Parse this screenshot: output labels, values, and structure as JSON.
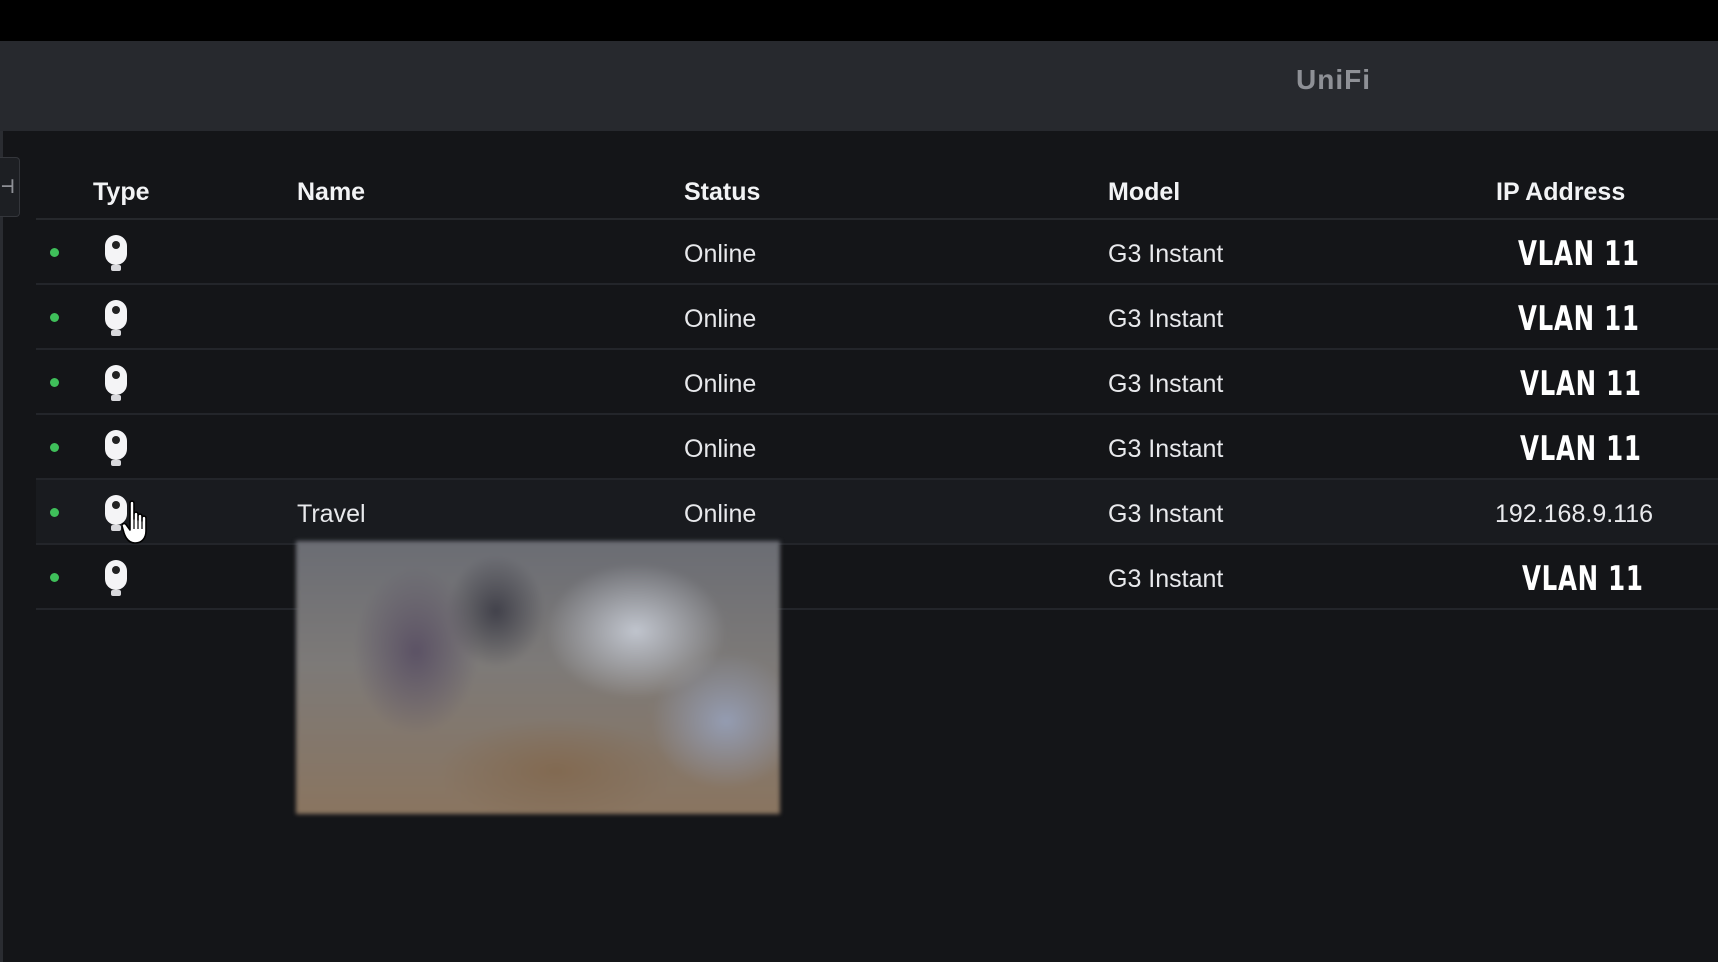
{
  "app": {
    "brand": "UniFi"
  },
  "sidebar": {
    "collapse_glyph": "⊣"
  },
  "table": {
    "columns": {
      "type": "Type",
      "name": "Name",
      "status": "Status",
      "model": "Model",
      "ip": "IP Address"
    },
    "rows": [
      {
        "name": "",
        "status": "Online",
        "model": "G3 Instant",
        "ip": "VLAN 11"
      },
      {
        "name": "",
        "status": "Online",
        "model": "G3 Instant",
        "ip": "VLAN 11"
      },
      {
        "name": "",
        "status": "Online",
        "model": "G3 Instant",
        "ip": "VLAN 11"
      },
      {
        "name": "",
        "status": "Online",
        "model": "G3 Instant",
        "ip": "VLAN 11"
      },
      {
        "name": "Travel",
        "status": "Online",
        "model": "G3 Instant",
        "ip": "192.168.9.116"
      },
      {
        "name": "",
        "status": "",
        "model": "G3 Instant",
        "ip": "VLAN 11"
      }
    ]
  },
  "icons": {
    "type": "camera-icon",
    "status_dot": "status-dot-icon",
    "cursor": "hand-pointer-icon"
  },
  "colors": {
    "online": "#3fbf5a",
    "topbar": "#27292e",
    "background": "#141518"
  }
}
